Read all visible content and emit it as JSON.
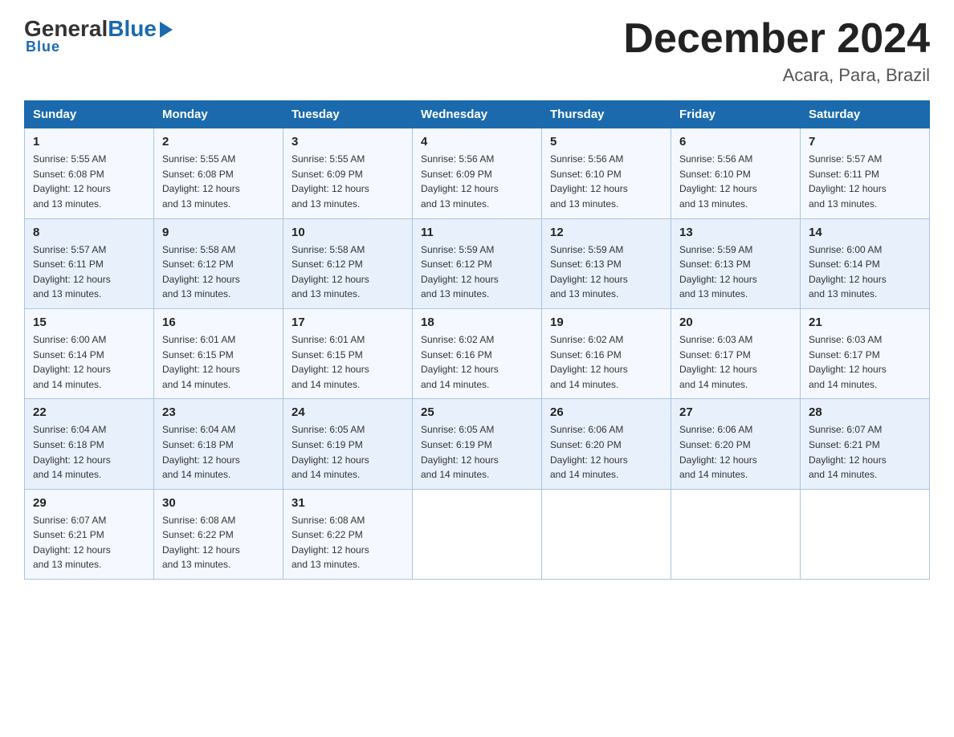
{
  "header": {
    "logo_general": "General",
    "logo_blue": "Blue",
    "title": "December 2024",
    "subtitle": "Acara, Para, Brazil"
  },
  "days_of_week": [
    "Sunday",
    "Monday",
    "Tuesday",
    "Wednesday",
    "Thursday",
    "Friday",
    "Saturday"
  ],
  "weeks": [
    [
      {
        "day": "1",
        "sunrise": "5:55 AM",
        "sunset": "6:08 PM",
        "daylight": "12 hours and 13 minutes."
      },
      {
        "day": "2",
        "sunrise": "5:55 AM",
        "sunset": "6:08 PM",
        "daylight": "12 hours and 13 minutes."
      },
      {
        "day": "3",
        "sunrise": "5:55 AM",
        "sunset": "6:09 PM",
        "daylight": "12 hours and 13 minutes."
      },
      {
        "day": "4",
        "sunrise": "5:56 AM",
        "sunset": "6:09 PM",
        "daylight": "12 hours and 13 minutes."
      },
      {
        "day": "5",
        "sunrise": "5:56 AM",
        "sunset": "6:10 PM",
        "daylight": "12 hours and 13 minutes."
      },
      {
        "day": "6",
        "sunrise": "5:56 AM",
        "sunset": "6:10 PM",
        "daylight": "12 hours and 13 minutes."
      },
      {
        "day": "7",
        "sunrise": "5:57 AM",
        "sunset": "6:11 PM",
        "daylight": "12 hours and 13 minutes."
      }
    ],
    [
      {
        "day": "8",
        "sunrise": "5:57 AM",
        "sunset": "6:11 PM",
        "daylight": "12 hours and 13 minutes."
      },
      {
        "day": "9",
        "sunrise": "5:58 AM",
        "sunset": "6:12 PM",
        "daylight": "12 hours and 13 minutes."
      },
      {
        "day": "10",
        "sunrise": "5:58 AM",
        "sunset": "6:12 PM",
        "daylight": "12 hours and 13 minutes."
      },
      {
        "day": "11",
        "sunrise": "5:59 AM",
        "sunset": "6:12 PM",
        "daylight": "12 hours and 13 minutes."
      },
      {
        "day": "12",
        "sunrise": "5:59 AM",
        "sunset": "6:13 PM",
        "daylight": "12 hours and 13 minutes."
      },
      {
        "day": "13",
        "sunrise": "5:59 AM",
        "sunset": "6:13 PM",
        "daylight": "12 hours and 13 minutes."
      },
      {
        "day": "14",
        "sunrise": "6:00 AM",
        "sunset": "6:14 PM",
        "daylight": "12 hours and 13 minutes."
      }
    ],
    [
      {
        "day": "15",
        "sunrise": "6:00 AM",
        "sunset": "6:14 PM",
        "daylight": "12 hours and 14 minutes."
      },
      {
        "day": "16",
        "sunrise": "6:01 AM",
        "sunset": "6:15 PM",
        "daylight": "12 hours and 14 minutes."
      },
      {
        "day": "17",
        "sunrise": "6:01 AM",
        "sunset": "6:15 PM",
        "daylight": "12 hours and 14 minutes."
      },
      {
        "day": "18",
        "sunrise": "6:02 AM",
        "sunset": "6:16 PM",
        "daylight": "12 hours and 14 minutes."
      },
      {
        "day": "19",
        "sunrise": "6:02 AM",
        "sunset": "6:16 PM",
        "daylight": "12 hours and 14 minutes."
      },
      {
        "day": "20",
        "sunrise": "6:03 AM",
        "sunset": "6:17 PM",
        "daylight": "12 hours and 14 minutes."
      },
      {
        "day": "21",
        "sunrise": "6:03 AM",
        "sunset": "6:17 PM",
        "daylight": "12 hours and 14 minutes."
      }
    ],
    [
      {
        "day": "22",
        "sunrise": "6:04 AM",
        "sunset": "6:18 PM",
        "daylight": "12 hours and 14 minutes."
      },
      {
        "day": "23",
        "sunrise": "6:04 AM",
        "sunset": "6:18 PM",
        "daylight": "12 hours and 14 minutes."
      },
      {
        "day": "24",
        "sunrise": "6:05 AM",
        "sunset": "6:19 PM",
        "daylight": "12 hours and 14 minutes."
      },
      {
        "day": "25",
        "sunrise": "6:05 AM",
        "sunset": "6:19 PM",
        "daylight": "12 hours and 14 minutes."
      },
      {
        "day": "26",
        "sunrise": "6:06 AM",
        "sunset": "6:20 PM",
        "daylight": "12 hours and 14 minutes."
      },
      {
        "day": "27",
        "sunrise": "6:06 AM",
        "sunset": "6:20 PM",
        "daylight": "12 hours and 14 minutes."
      },
      {
        "day": "28",
        "sunrise": "6:07 AM",
        "sunset": "6:21 PM",
        "daylight": "12 hours and 14 minutes."
      }
    ],
    [
      {
        "day": "29",
        "sunrise": "6:07 AM",
        "sunset": "6:21 PM",
        "daylight": "12 hours and 13 minutes."
      },
      {
        "day": "30",
        "sunrise": "6:08 AM",
        "sunset": "6:22 PM",
        "daylight": "12 hours and 13 minutes."
      },
      {
        "day": "31",
        "sunrise": "6:08 AM",
        "sunset": "6:22 PM",
        "daylight": "12 hours and 13 minutes."
      },
      null,
      null,
      null,
      null
    ]
  ],
  "labels": {
    "sunrise": "Sunrise:",
    "sunset": "Sunset:",
    "daylight": "Daylight:"
  }
}
